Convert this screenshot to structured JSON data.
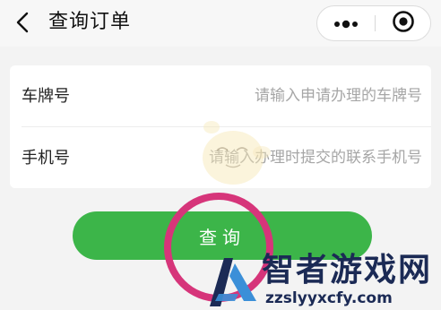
{
  "header": {
    "title": "查询订单",
    "back_icon": "chevron-left-icon",
    "more_icon": "more-dots-icon",
    "close_icon": "target-close-icon"
  },
  "form": {
    "plate": {
      "label": "车牌号",
      "placeholder": "请输入申请办理的车牌号",
      "value": ""
    },
    "phone": {
      "label": "手机号",
      "placeholder": "请输入办理时提交的联系手机号",
      "value": ""
    }
  },
  "button": {
    "label": "查询"
  },
  "watermark": {
    "text": "智者游戏网",
    "url": "zzslyyxcfy.com"
  },
  "colors": {
    "accent": "#3cb549",
    "highlight_ring": "#d6357a",
    "watermark": "#1b2a55"
  }
}
